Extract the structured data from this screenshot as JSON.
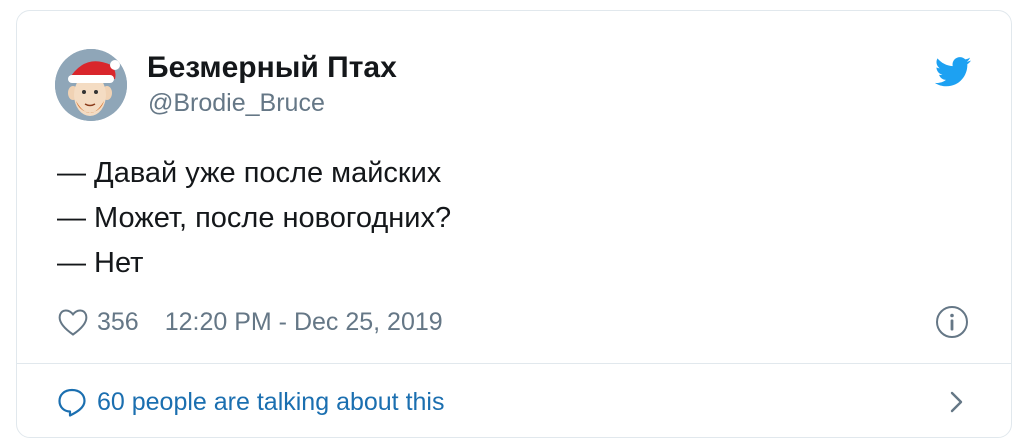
{
  "tweet": {
    "author": {
      "display_name": "Безмерный Птах",
      "handle": "@Brodie_Bruce",
      "avatar_icon": "avatar-santa-hat-cartoon"
    },
    "text_lines": [
      "— Давай уже после майских",
      "— Может, после новогодних?",
      "— Нет"
    ],
    "likes": "356",
    "timestamp": "12:20 PM - Dec 25, 2019",
    "talking_label": "60 people are talking about this"
  },
  "icons": {
    "brand": "twitter-bird-icon",
    "like": "heart-icon",
    "info": "info-icon",
    "talking": "speech-bubble-icon",
    "more": "chevron-right-icon"
  },
  "colors": {
    "twitter_blue": "#1da1f2",
    "link_blue": "#1b6fb0",
    "secondary_text": "#657786",
    "border": "#e1e8ed"
  }
}
